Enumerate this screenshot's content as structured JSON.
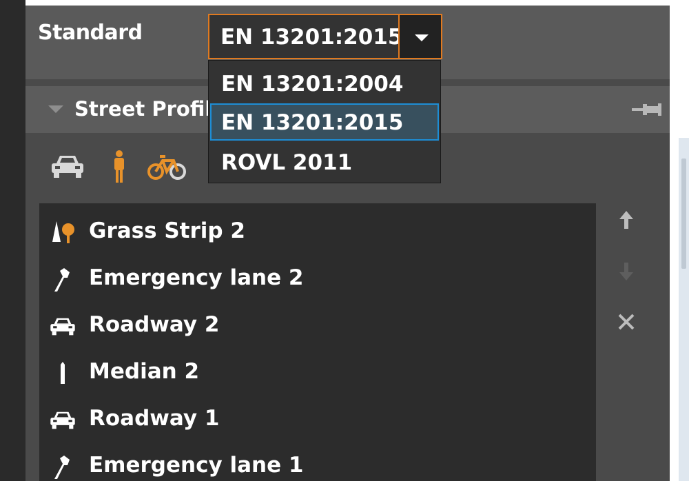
{
  "standard": {
    "label": "Standard",
    "selected": "EN 13201:2015",
    "options": [
      "EN 13201:2004",
      "EN 13201:2015",
      "ROVL 2011"
    ]
  },
  "street_profile": {
    "title": "Street Profile",
    "type_icons": [
      "car-icon",
      "pedestrian-icon",
      "bicycle-icon"
    ],
    "items": [
      {
        "label": "Grass Strip 2",
        "icon": "grass-strip-icon"
      },
      {
        "label": "Emergency lane 2",
        "icon": "wrench-icon"
      },
      {
        "label": "Roadway 2",
        "icon": "car-icon"
      },
      {
        "label": "Median 2",
        "icon": "median-icon"
      },
      {
        "label": "Roadway 1",
        "icon": "car-icon"
      },
      {
        "label": "Emergency lane 1",
        "icon": "wrench-icon"
      }
    ],
    "side_buttons": [
      "move-up-icon",
      "move-down-icon",
      "delete-icon"
    ]
  },
  "colors": {
    "accent_orange": "#e07a20",
    "selection_blue": "#1d8ed6",
    "pedestrian_orange": "#e8922a"
  }
}
